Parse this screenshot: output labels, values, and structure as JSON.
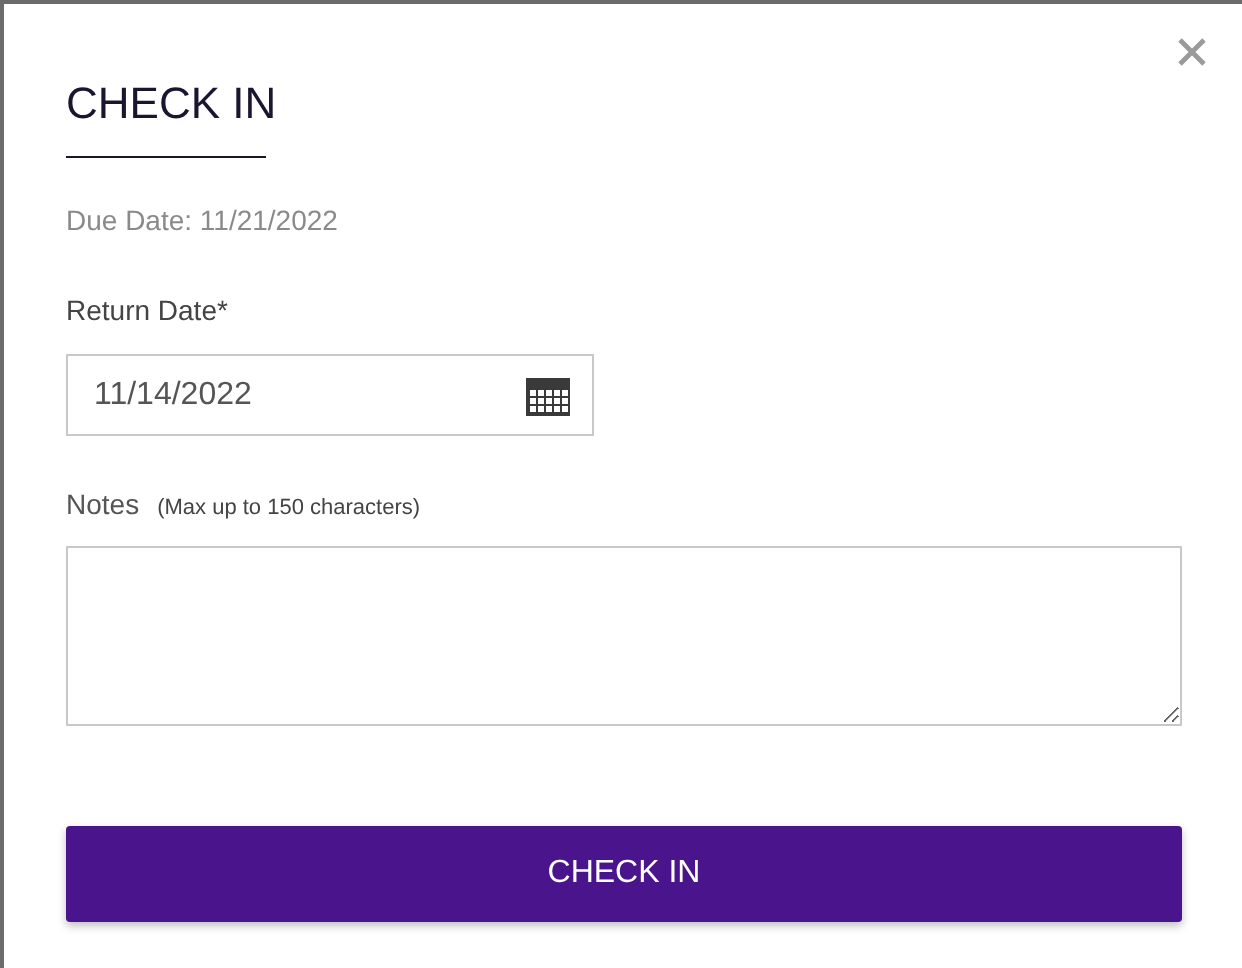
{
  "dialog": {
    "title": "CHECK IN",
    "due_date": "Due Date: 11/21/2022",
    "return_date": {
      "label": "Return Date*",
      "value": "11/14/2022"
    },
    "notes": {
      "label": "Notes",
      "hint": "(Max up to 150 characters)"
    },
    "submit": "CHECK IN"
  }
}
